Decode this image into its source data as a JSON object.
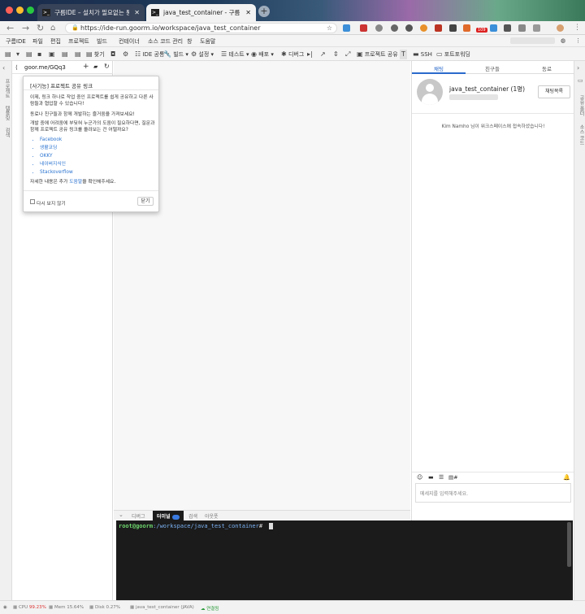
{
  "browser": {
    "tabs": [
      {
        "title": "구름IDE – 설치가 필요없는 통합개발환경",
        "favicon": ">_"
      },
      {
        "title": "java_test_container - 구름IDE",
        "favicon": ">_"
      }
    ],
    "url": "https://ide-run.goorm.io/workspace/java_test_container",
    "badge": "109"
  },
  "menu": [
    "구름IDE",
    "파일",
    "편집",
    "프로젝트",
    "빌드",
    "컨테이너",
    "소스 코드 관리",
    "창",
    "도움말"
  ],
  "toolbar": {
    "find": "찾기",
    "ide": "IDE 공통",
    "build": "빌드",
    "settings": "설정",
    "test": "테스트",
    "deploy": "배포",
    "debug": "디버그",
    "share": "프로젝트 공유",
    "ssh": "SSH",
    "port": "포트포워딩"
  },
  "left_rail": [
    "프로젝트",
    "템플릿",
    "검색"
  ],
  "project_panel": {
    "share_link": "goor.me/GQq3"
  },
  "popup": {
    "title": "[사기능] 프로젝트 공유 링크",
    "p1": "이제, 링크 하나로 작업 중인 프로젝트를 쉽게 공유하고 다른 사람들과 협업할 수 있습니다!",
    "p2": "동료나 친구들과 함께 개발하는 즐거움을 가져보세요!",
    "p3": "개발 중에 어려움에 부딪혀 누군가의 도움이 필요하다면, 질문과 함께 프로젝트 공유 링크를 올려보는 건 어떨까요?",
    "links": [
      "Facebook",
      "생활코딩",
      "OKKY",
      "네이버지식인",
      "Stackoverflow"
    ],
    "more_pre": "자세한 내용은 추가 ",
    "more_link": "도움말",
    "more_post": "을 확인해주세요.",
    "checkbox": "다시 보지 않기",
    "close": "닫기"
  },
  "right_panel": {
    "tabs": [
      "채팅",
      "친구들",
      "동료"
    ],
    "container_name": "java_test_container (1명)",
    "chat_list_btn": "채팅목록",
    "system_msg": "Kim Namho 님이 워크스페이스에 접속하셨습니다!",
    "input_placeholder": "메세지를 입력해주세요."
  },
  "right_rail": [
    "공유 폴더",
    "소스 코드"
  ],
  "bottom_tabs": [
    "디버그",
    "터미널",
    "검색",
    "아웃풋"
  ],
  "terminal": {
    "user": "root@goorm",
    "path": ":/workspace/java_test_container",
    "prompt": "#"
  },
  "status": {
    "cpu_label": "CPU",
    "cpu_val": "99.23%",
    "mem": "Mem 15.64%",
    "disk": "Disk 0.27%",
    "container": "java_test_container (JAVA)",
    "connected": "연결됨"
  },
  "colors": {
    "accent": "#2a6acb",
    "cpu": "#d33",
    "connected": "#2a9a3a"
  }
}
